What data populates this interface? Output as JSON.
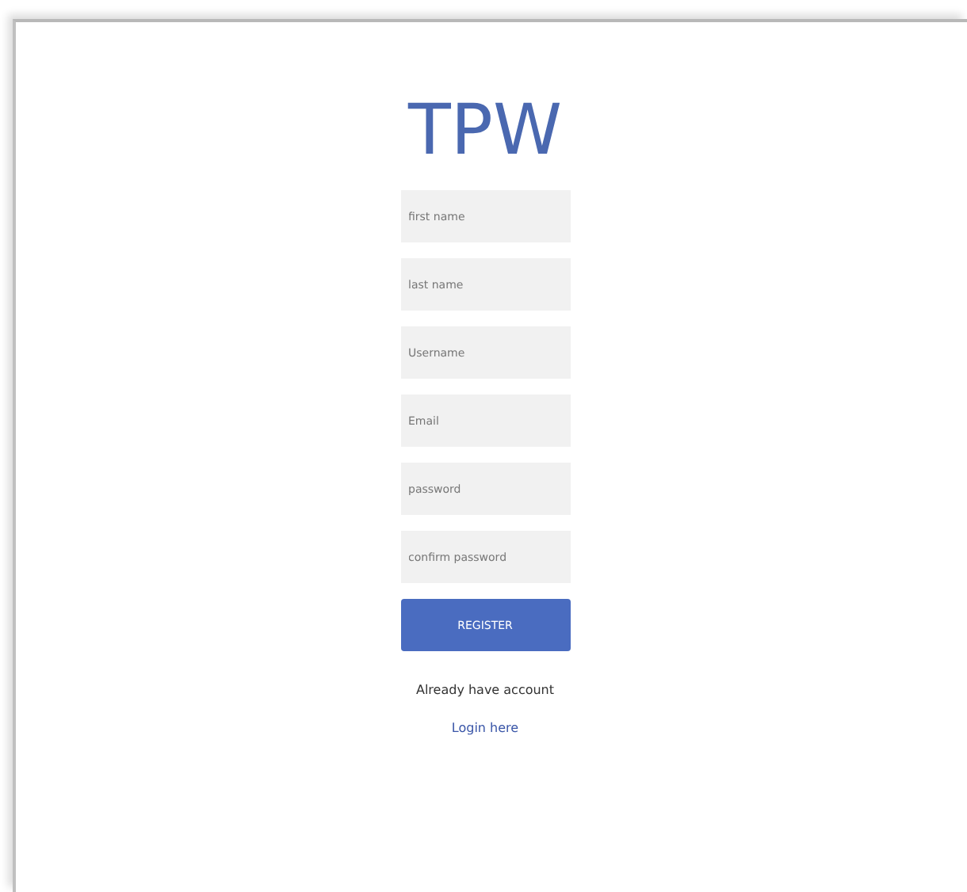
{
  "logo": "TPW",
  "fields": [
    {
      "placeholder": "first name"
    },
    {
      "placeholder": "last name"
    },
    {
      "placeholder": "Username"
    },
    {
      "placeholder": "Email"
    },
    {
      "placeholder": "password"
    },
    {
      "placeholder": "confirm password"
    }
  ],
  "register_button": "REGISTER",
  "prompt": "Already have account",
  "login_link": "Login here"
}
